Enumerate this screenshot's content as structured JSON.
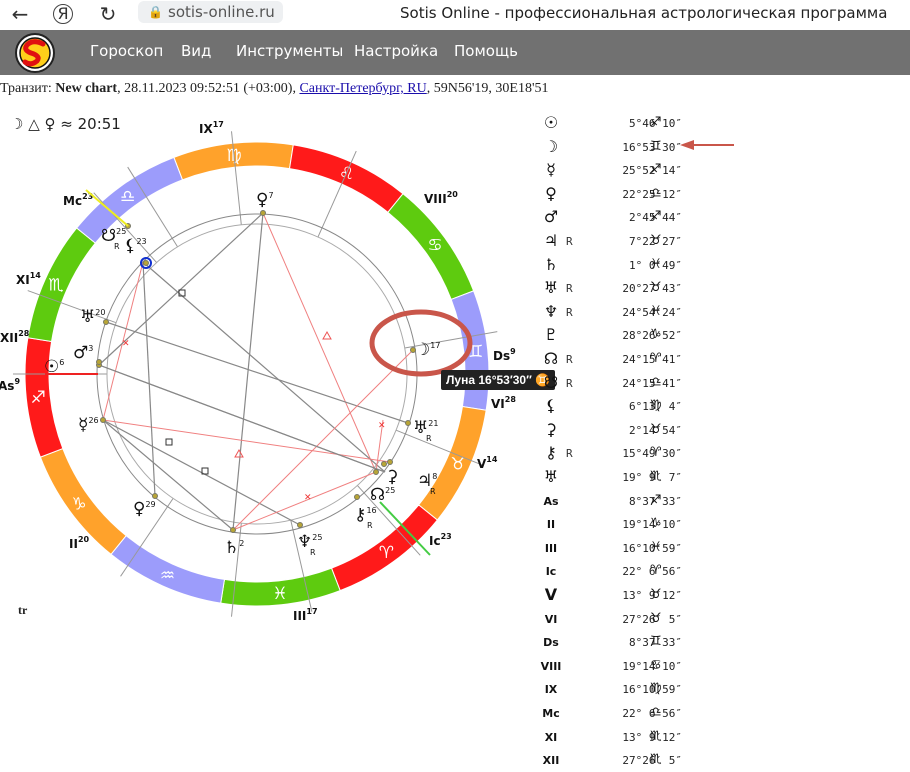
{
  "browser": {
    "url": "sotis-online.ru",
    "page_title": "Sotis Online - профессиональная астрологическая программа"
  },
  "menu": [
    "Гороскоп",
    "Вид",
    "Инструменты",
    "Настройка",
    "Помощь"
  ],
  "transit": {
    "prefix": "Транзит:",
    "chart_name": "New chart",
    "datetime": "28.11.2023 09:52:51 (+03:00),",
    "location": "Санкт-Петербург, RU",
    "coords": "59N56'19, 30E18'51"
  },
  "aspect_note": "☽ △ ♀ ≈ 20:51",
  "tr_label": "tr",
  "tooltip": "Луна 16°53′30″ ♊",
  "wheel": {
    "signs": [
      "♍",
      "♌",
      "♋",
      "♊",
      "♉",
      "♈",
      "♓",
      "♒",
      "♑",
      "♐",
      "♏",
      "♎"
    ],
    "sign_colors": [
      "#ffa22b",
      "#ff1a1a",
      "#5ecb0f",
      "#9c9cfb",
      "#ffa22b",
      "#ff1a1a",
      "#5ecb0f",
      "#9c9cfb",
      "#ffa22b",
      "#ff1a1a",
      "#5ecb0f",
      "#9c9cfb"
    ],
    "house_labels": [
      {
        "t": "IX",
        "n": "17"
      },
      {
        "t": "VIII",
        "n": "20"
      },
      {
        "t": "Ds",
        "n": "9"
      },
      {
        "t": "VI",
        "n": "28"
      },
      {
        "t": "V",
        "n": "14"
      },
      {
        "t": "Ic",
        "n": "23"
      },
      {
        "t": "III",
        "n": "17"
      },
      {
        "t": "II",
        "n": "20"
      },
      {
        "t": "As",
        "n": "9"
      },
      {
        "t": "XII",
        "n": "28"
      },
      {
        "t": "XI",
        "n": "14"
      },
      {
        "t": "Mc",
        "n": "23"
      }
    ],
    "planet_labels": [
      {
        "g": "♀",
        "n": "7"
      },
      {
        "g": "☽",
        "n": "17"
      },
      {
        "g": "♅",
        "n": "21",
        "r": "R"
      },
      {
        "g": "♃",
        "n": "8",
        "r": "R"
      },
      {
        "g": "⚳",
        "n": ""
      },
      {
        "g": "☊",
        "n": "25"
      },
      {
        "g": "⚷",
        "n": "16",
        "r": "R"
      },
      {
        "g": "♆",
        "n": "25",
        "r": "R"
      },
      {
        "g": "♄",
        "n": "2"
      },
      {
        "g": "♀",
        "n": "29"
      },
      {
        "g": "☿",
        "n": "26"
      },
      {
        "g": "☉",
        "n": "6"
      },
      {
        "g": "♂",
        "n": "3"
      },
      {
        "g": "♅",
        "n": "20"
      },
      {
        "g": "⚸",
        "n": "23"
      },
      {
        "g": "☋",
        "n": "25",
        "r": "R"
      }
    ]
  },
  "positions": [
    {
      "sym": "☉",
      "r": "",
      "v": "5°46′10″",
      "z": "♐"
    },
    {
      "sym": "☽",
      "r": "",
      "v": "16°53′30″",
      "z": "♊"
    },
    {
      "sym": "☿",
      "r": "",
      "v": "25°52′14″",
      "z": "♐"
    },
    {
      "sym": "♀",
      "r": "",
      "v": "22°25′12″",
      "z": "♎"
    },
    {
      "sym": "♂",
      "r": "",
      "v": "2°45′44″",
      "z": "♐"
    },
    {
      "sym": "♃",
      "r": "R",
      "v": "7°22′27″",
      "z": "♉"
    },
    {
      "sym": "♄",
      "r": "",
      "v": "1° 0′49″",
      "z": "♓"
    },
    {
      "sym": "♅",
      "r": "R",
      "v": "20°27′43″",
      "z": "♉"
    },
    {
      "sym": "♆",
      "r": "R",
      "v": "24°54′24″",
      "z": "♓"
    },
    {
      "sym": "♇",
      "r": "",
      "v": "28°26′52″",
      "z": "♑"
    },
    {
      "sym": "☊",
      "r": "R",
      "v": "24°15′41″",
      "z": "♈"
    },
    {
      "sym": "☋",
      "r": "R",
      "v": "24°15′41″",
      "z": "♎"
    },
    {
      "sym": "⚸",
      "r": "",
      "v": "6°13′ 4″",
      "z": "♍"
    },
    {
      "sym": "⚳",
      "r": "",
      "v": "2°14′54″",
      "z": "♉"
    },
    {
      "sym": "⚷",
      "r": "R",
      "v": "15°49′30″",
      "z": "♈"
    },
    {
      "sym": "♅",
      "r": "",
      "v": "19° 9′ 7″",
      "z": "♏"
    },
    {
      "sym": "As",
      "r": "",
      "v": "8°37′33″",
      "z": "♐"
    },
    {
      "sym": "II",
      "r": "",
      "v": "19°14′10″",
      "z": "♑"
    },
    {
      "sym": "III",
      "r": "",
      "v": "16°10′59″",
      "z": "♓"
    },
    {
      "sym": "Ic",
      "r": "",
      "v": "22° 6′56″",
      "z": "♈"
    },
    {
      "sym": "V",
      "r": "",
      "v": "13° 9′12″",
      "z": "♉"
    },
    {
      "sym": "VI",
      "r": "",
      "v": "27°26′ 5″",
      "z": "♉"
    },
    {
      "sym": "Ds",
      "r": "",
      "v": "8°37′33″",
      "z": "♊"
    },
    {
      "sym": "VIII",
      "r": "",
      "v": "19°14′10″",
      "z": "♋"
    },
    {
      "sym": "IX",
      "r": "",
      "v": "16°10′59″",
      "z": "♍"
    },
    {
      "sym": "Mc",
      "r": "",
      "v": "22° 6′56″",
      "z": "♎"
    },
    {
      "sym": "XI",
      "r": "",
      "v": "13° 9′12″",
      "z": "♏"
    },
    {
      "sym": "XII",
      "r": "",
      "v": "27°26′ 5″",
      "z": "♏"
    }
  ]
}
